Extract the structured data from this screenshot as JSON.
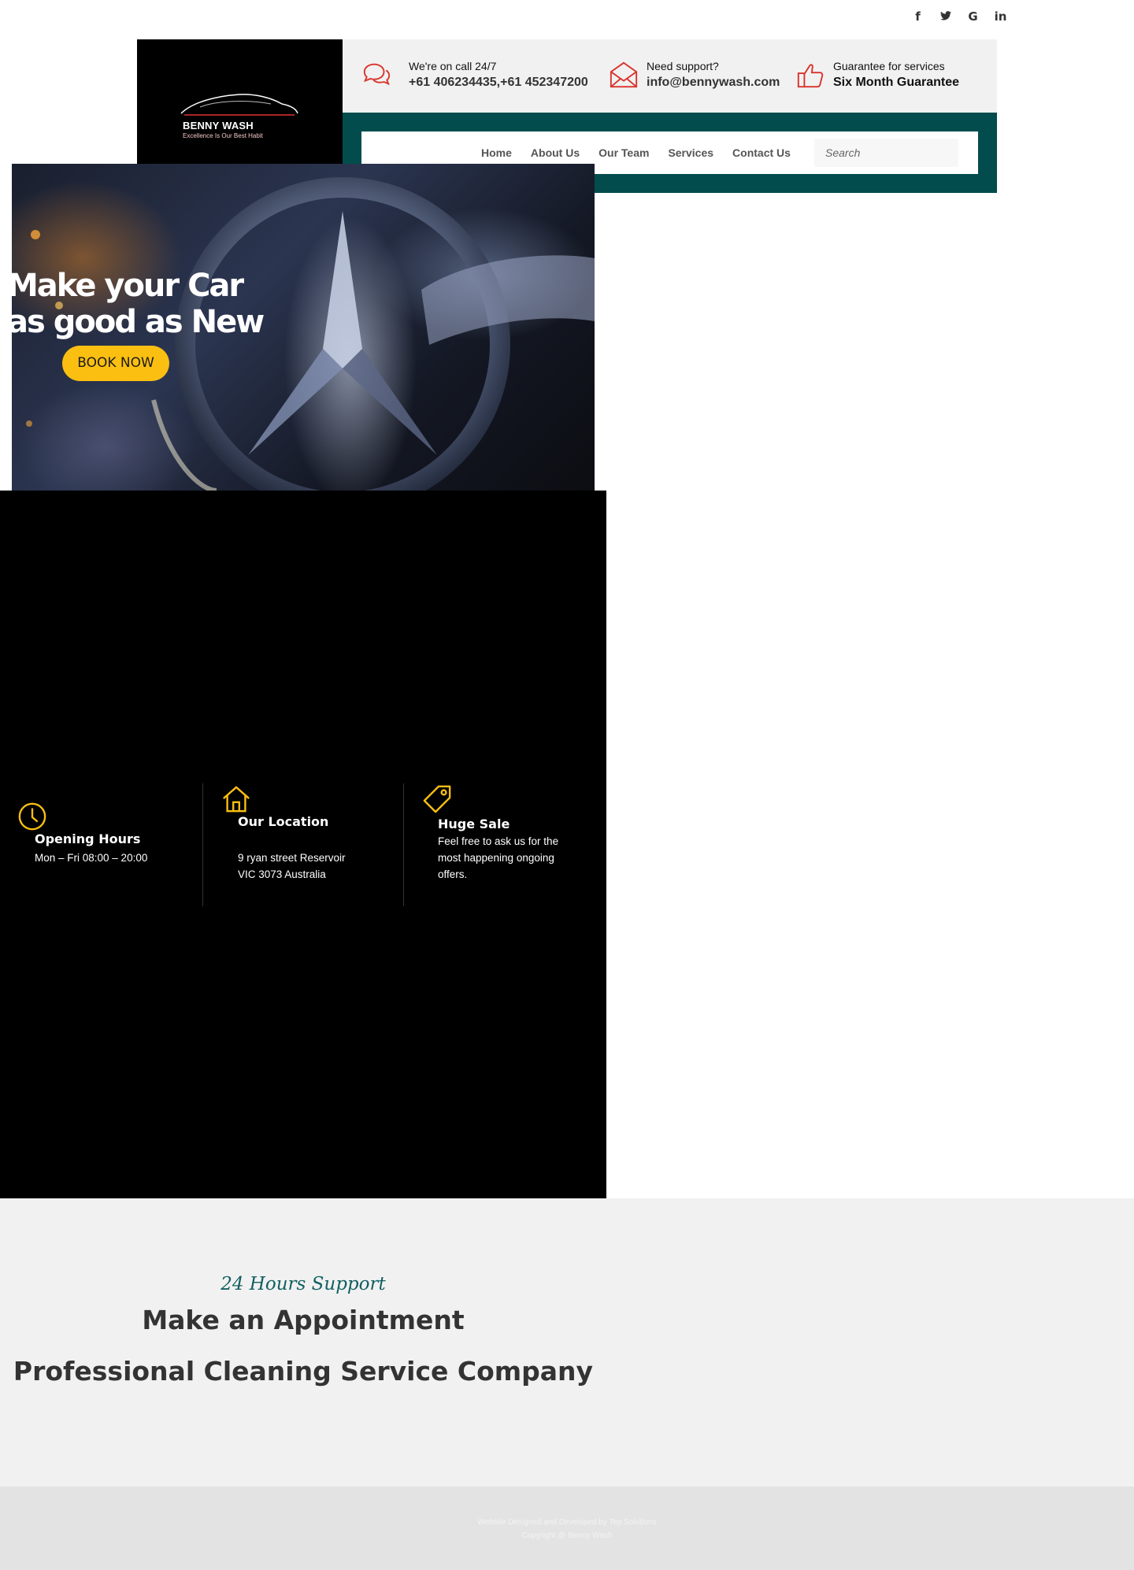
{
  "social": {
    "facebook": "f",
    "twitter": "🐦",
    "google": "G",
    "linkedin": "in"
  },
  "logo": {
    "title": "BENNY WASH",
    "tagline": "Excellence Is Our Best Habit"
  },
  "info": [
    {
      "label": "We're on call 24/7",
      "value": "+61 406234435,+61 452347200",
      "icon": "chat-bubbles-icon"
    },
    {
      "label": "Need support?",
      "value": "info@bennywash.com",
      "icon": "envelope-icon"
    },
    {
      "label": "Guarantee for services",
      "value": "Six Month Guarantee",
      "icon": "thumbs-up-icon"
    }
  ],
  "nav": {
    "items": [
      "Home",
      "About Us",
      "Our Team",
      "Services",
      "Contact Us"
    ],
    "search_placeholder": "Search"
  },
  "hero": {
    "title_line1": "Make your Car",
    "title_line2": "as good as New",
    "button": "BOOK NOW"
  },
  "features": [
    {
      "title": "Opening Hours",
      "desc": "Mon – Fri 08:00 – 20:00",
      "icon": "clock-icon"
    },
    {
      "title": "Our Location",
      "desc_line1": "9 ryan street Reservoir",
      "desc_line2": "VIC 3073 Australia",
      "icon": "house-icon"
    },
    {
      "title": "Huge Sale",
      "desc_line1": "Feel free to ask us for the",
      "desc_line2": "most happening ongoing",
      "desc_line3": "offers.",
      "icon": "tag-icon"
    }
  ],
  "appointment": {
    "subtitle": "24 Hours Support",
    "heading": "Make an Appointment",
    "heading2": "Professional Cleaning Service Company"
  },
  "footer": {
    "line1": "Website Designed and Developed by Tep Solutions",
    "line2": "Copyright @ Benny Wash"
  },
  "colors": {
    "accent_red": "#d9342b",
    "nav_teal": "#024c4d",
    "yellow": "#fbbf12",
    "subtitle_teal": "#125f62"
  }
}
